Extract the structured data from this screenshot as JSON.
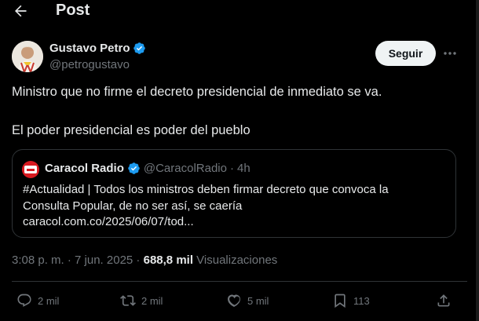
{
  "header": {
    "title": "Post"
  },
  "author": {
    "name": "Gustavo Petro",
    "handle": "@petrogustavo",
    "verified_color": "#1d9bf0"
  },
  "follow_button": {
    "label": "Seguir"
  },
  "tweet": {
    "line1": "Ministro que no firme el decreto presidencial de inmediato se va.",
    "line2": "El poder presidencial es poder del pueblo"
  },
  "quote": {
    "name": "Caracol Radio",
    "handle": "@CaracolRadio",
    "separator": "·",
    "time": "4h",
    "text_lines": [
      "#Actualidad | Todos los ministros deben firmar decreto que convoca la",
      "Consulta Popular, de no ser así, se caería",
      "caracol.com.co/2025/06/07/tod..."
    ]
  },
  "meta": {
    "timestamp": "3:08 p. m. · 7 jun. 2025 ·",
    "views_count": "688,8 mil",
    "views_label": "Visualizaciones"
  },
  "actions": {
    "replies": "2 mil",
    "reposts": "2 mil",
    "likes": "5 mil",
    "bookmarks": "113"
  },
  "icons": [
    "back-arrow-icon",
    "verified-icon",
    "more-icon",
    "reply-icon",
    "repost-icon",
    "like-icon",
    "bookmark-icon",
    "share-icon"
  ]
}
